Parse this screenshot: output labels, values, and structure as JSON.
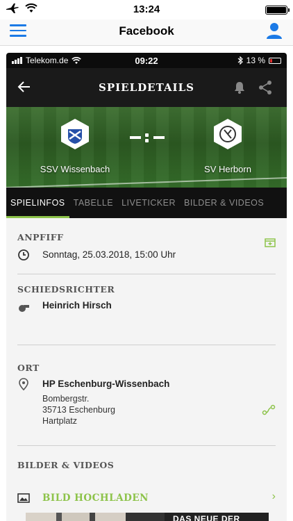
{
  "outer_status": {
    "time": "13:24"
  },
  "outer_nav": {
    "title": "Facebook"
  },
  "inner_status": {
    "carrier": "Telekom.de",
    "time": "09:22",
    "battery": "13 %"
  },
  "inner_appbar": {
    "title": "SPIELDETAILS"
  },
  "match": {
    "home_team": "SSV Wissenbach",
    "away_team": "SV Herborn",
    "score_placeholder": "-:-"
  },
  "tabs": [
    {
      "label": "SPIELINFOS",
      "active": true
    },
    {
      "label": "TABELLE",
      "active": false
    },
    {
      "label": "LIVETICKER",
      "active": false
    },
    {
      "label": "BILDER & VIDEOS",
      "active": false
    }
  ],
  "anpfiff": {
    "title": "ANPFIFF",
    "datetime": "Sonntag, 25.03.2018, 15:00 Uhr"
  },
  "schiedsrichter": {
    "title": "SCHIEDSRICHTER",
    "name": "Heinrich Hirsch"
  },
  "ort": {
    "title": "ORT",
    "venue": "HP Eschenburg-Wissenbach",
    "street": "Bombergstr.",
    "city": "35713 Eschenburg",
    "field": "Hartplatz"
  },
  "media": {
    "title": "BILDER & VIDEOS",
    "upload_label": "BILD HOCHLADEN",
    "banner_text": "DAS NEUE DER"
  },
  "colors": {
    "accent_green": "#8dc34a",
    "ios_blue": "#1b7ae6",
    "dark_bar": "#1a1a1a"
  },
  "icons": [
    "airplane-icon",
    "wifi-icon",
    "hamburger-menu-icon",
    "user-icon",
    "back-arrow-icon",
    "bell-icon",
    "share-icon",
    "clock-icon",
    "whistle-icon",
    "location-pin-icon",
    "calendar-add-icon",
    "route-icon",
    "image-icon",
    "chevron-right-icon"
  ]
}
